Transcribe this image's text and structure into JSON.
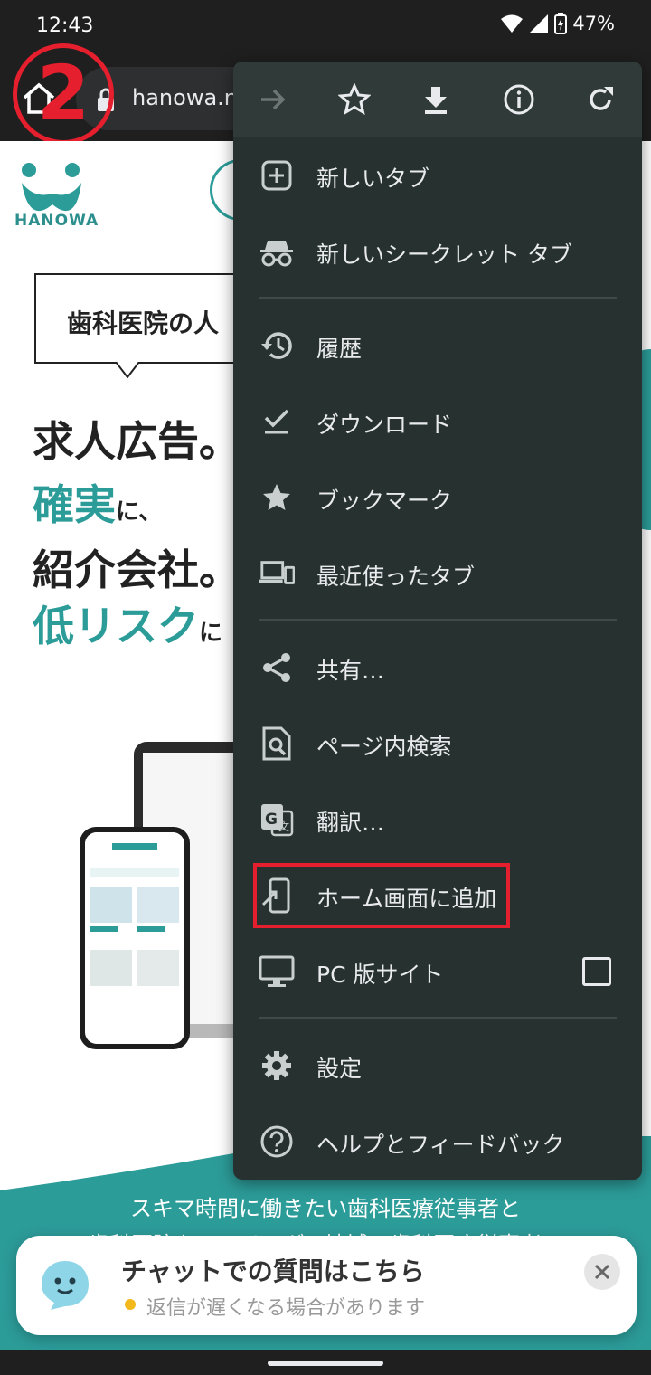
{
  "status_bar": {
    "time": "12:43",
    "battery": "47%"
  },
  "browser": {
    "url": "hanowa.n",
    "step_marker": "2"
  },
  "page": {
    "logo_text": "HANOWA",
    "speech_text": "歯科医院の人",
    "headline": [
      {
        "main": "求人広告",
        "tail": "。",
        "teal": false
      },
      {
        "main": "確実",
        "tail": "に、",
        "teal": true
      },
      {
        "main": "紹介会社",
        "tail": "。",
        "teal": false
      },
      {
        "main": "低リスク",
        "tail": "に",
        "teal": true
      }
    ],
    "footer_text_1": "スキマ時間に働きたい歯科医療従事者と",
    "footer_text_2": "歯科医院をマッチング。地域の歯科医療従事者の"
  },
  "menu": {
    "actions": [
      {
        "name": "forward-icon",
        "enabled": false
      },
      {
        "name": "star-outline-icon",
        "enabled": true
      },
      {
        "name": "download-icon",
        "enabled": true
      },
      {
        "name": "info-icon",
        "enabled": true
      },
      {
        "name": "refresh-icon",
        "enabled": true
      }
    ],
    "items": [
      {
        "label": "新しいタブ",
        "icon": "new-tab-icon"
      },
      {
        "label": "新しいシークレット タブ",
        "icon": "incognito-icon"
      },
      {
        "label": "履歴",
        "icon": "history-icon"
      },
      {
        "label": "ダウンロード",
        "icon": "downloads-icon"
      },
      {
        "label": "ブックマーク",
        "icon": "bookmark-star-icon"
      },
      {
        "label": "最近使ったタブ",
        "icon": "recent-tabs-icon"
      },
      {
        "label": "共有…",
        "icon": "share-icon"
      },
      {
        "label": "ページ内検索",
        "icon": "find-in-page-icon"
      },
      {
        "label": "翻訳…",
        "icon": "translate-icon"
      },
      {
        "label": "ホーム画面に追加",
        "icon": "add-to-home-icon",
        "highlighted": true
      },
      {
        "label": "PC 版サイト",
        "icon": "desktop-icon",
        "checkbox": false
      },
      {
        "label": "設定",
        "icon": "settings-gear-icon"
      },
      {
        "label": "ヘルプとフィードバック",
        "icon": "help-icon"
      }
    ]
  },
  "chat_banner": {
    "title": "チャットでの質問はこちら",
    "subtitle": "返信が遅くなる場合があります"
  },
  "colors": {
    "teal": "#2c9c99",
    "menu_bg": "#273130",
    "highlight": "#e51f2d"
  }
}
